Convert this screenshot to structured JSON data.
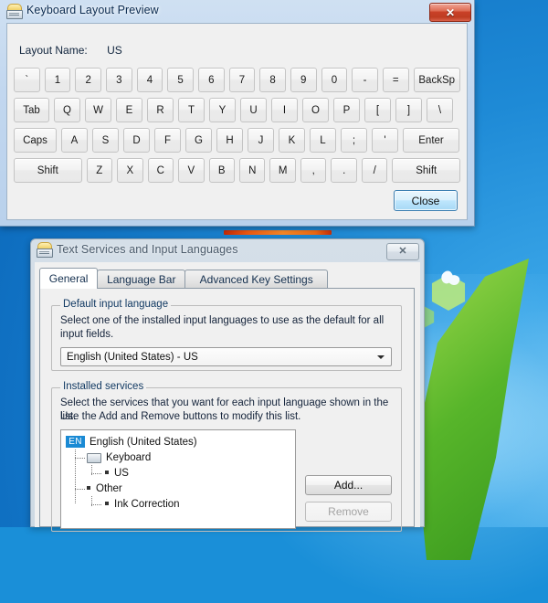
{
  "desktop": {
    "wallpaper_sky": "#1e8ad6",
    "wallpaper_leaf": "#57b52a"
  },
  "hidden_window": {
    "accent": "#f05a12"
  },
  "keyboard_preview_window": {
    "title": "Keyboard Layout Preview",
    "icon": "keyboard-layout-icon",
    "close_label": "✕",
    "layout_name_label": "Layout Name:",
    "layout_name_value": "US",
    "close_button": "Close",
    "rows": [
      [
        {
          "label": "`",
          "cls": "k1"
        },
        {
          "label": "1",
          "cls": "k1"
        },
        {
          "label": "2",
          "cls": "k1"
        },
        {
          "label": "3",
          "cls": "k1"
        },
        {
          "label": "4",
          "cls": "k1"
        },
        {
          "label": "5",
          "cls": "k1"
        },
        {
          "label": "6",
          "cls": "k1"
        },
        {
          "label": "7",
          "cls": "k1"
        },
        {
          "label": "8",
          "cls": "k1"
        },
        {
          "label": "9",
          "cls": "k1"
        },
        {
          "label": "0",
          "cls": "k1"
        },
        {
          "label": "-",
          "cls": "k1"
        },
        {
          "label": "=",
          "cls": "k1"
        },
        {
          "label": "BackSp",
          "cls": "kbsp"
        }
      ],
      [
        {
          "label": "Tab",
          "cls": "ktab"
        },
        {
          "label": "Q",
          "cls": "k1"
        },
        {
          "label": "W",
          "cls": "k1"
        },
        {
          "label": "E",
          "cls": "k1"
        },
        {
          "label": "R",
          "cls": "k1"
        },
        {
          "label": "T",
          "cls": "k1"
        },
        {
          "label": "Y",
          "cls": "k1"
        },
        {
          "label": "U",
          "cls": "k1"
        },
        {
          "label": "I",
          "cls": "k1"
        },
        {
          "label": "O",
          "cls": "k1"
        },
        {
          "label": "P",
          "cls": "k1"
        },
        {
          "label": "[",
          "cls": "k1"
        },
        {
          "label": "]",
          "cls": "k1"
        },
        {
          "label": "\\",
          "cls": "k1"
        }
      ],
      [
        {
          "label": "Caps",
          "cls": "kcaps"
        },
        {
          "label": "A",
          "cls": "k1"
        },
        {
          "label": "S",
          "cls": "k1"
        },
        {
          "label": "D",
          "cls": "k1"
        },
        {
          "label": "F",
          "cls": "k1"
        },
        {
          "label": "G",
          "cls": "k1"
        },
        {
          "label": "H",
          "cls": "k1"
        },
        {
          "label": "J",
          "cls": "k1"
        },
        {
          "label": "K",
          "cls": "k1"
        },
        {
          "label": "L",
          "cls": "k1"
        },
        {
          "label": ";",
          "cls": "k1"
        },
        {
          "label": "'",
          "cls": "k1"
        },
        {
          "label": "Enter",
          "cls": "kenter"
        }
      ],
      [
        {
          "label": "Shift",
          "cls": "kshift"
        },
        {
          "label": "Z",
          "cls": "k1"
        },
        {
          "label": "X",
          "cls": "k1"
        },
        {
          "label": "C",
          "cls": "k1"
        },
        {
          "label": "V",
          "cls": "k1"
        },
        {
          "label": "B",
          "cls": "k1"
        },
        {
          "label": "N",
          "cls": "k1"
        },
        {
          "label": "M",
          "cls": "k1"
        },
        {
          "label": ",",
          "cls": "k1"
        },
        {
          "label": ".",
          "cls": "k1"
        },
        {
          "label": "/",
          "cls": "k1"
        },
        {
          "label": "Shift",
          "cls": "kshiftr"
        }
      ]
    ]
  },
  "text_services_window": {
    "title": "Text Services and Input Languages",
    "icon": "keyboard-layout-icon",
    "close_label": "✕",
    "tabs": [
      {
        "label": "General",
        "active": true
      },
      {
        "label": "Language Bar",
        "active": false
      },
      {
        "label": "Advanced Key Settings",
        "active": false
      }
    ],
    "default_input_language": {
      "group_title": "Default input language",
      "description": "Select one of the installed input languages to use as the default for all input fields.",
      "selected": "English (United States) - US"
    },
    "installed_services": {
      "group_title": "Installed services",
      "description_line1": "Select the services that you want for each input language shown in the list.",
      "description_line2": "Use the Add and Remove buttons to modify this list.",
      "tree": {
        "language_badge": "EN",
        "language": "English (United States)",
        "nodes": [
          {
            "label": "Keyboard",
            "icon": "keyboard-icon",
            "children": [
              {
                "label": "US"
              }
            ]
          },
          {
            "label": "Other",
            "icon": "bullet",
            "children": [
              {
                "label": "Ink Correction"
              }
            ]
          }
        ]
      },
      "buttons": [
        {
          "label": "Add...",
          "disabled": false
        },
        {
          "label": "Remove",
          "disabled": true
        }
      ]
    }
  }
}
